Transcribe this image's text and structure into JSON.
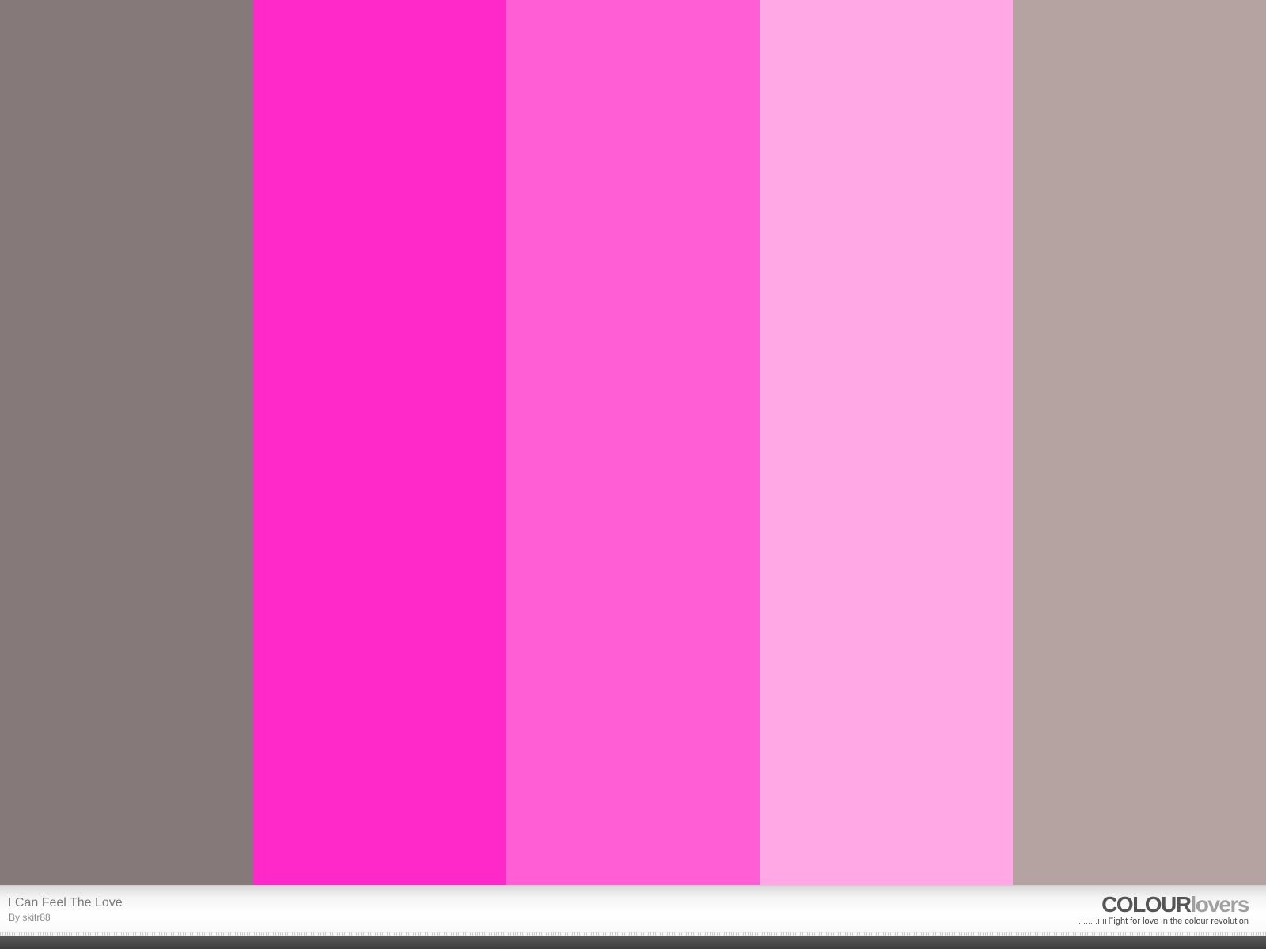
{
  "palette": {
    "title": "I Can Feel The Love",
    "author": "By skitr88",
    "colors": [
      "#857A79",
      "#FF29C9",
      "#FF5ED5",
      "#FFA8E5",
      "#B5A3A2"
    ]
  },
  "branding": {
    "logo_strong": "COLOUR",
    "logo_light": "lovers",
    "tagline": "Fight for love in the colour revolution"
  }
}
